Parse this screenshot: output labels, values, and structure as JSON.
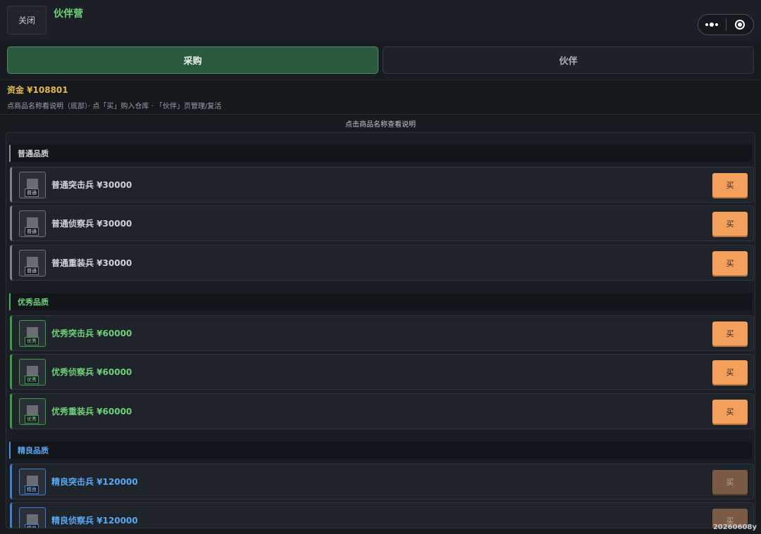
{
  "header": {
    "close_label": "关闭",
    "title": "伙伴营"
  },
  "capsule": {
    "more_icon": "more-dots-icon",
    "record_icon": "target-icon"
  },
  "tabs": [
    {
      "label": "采购",
      "active": true
    },
    {
      "label": "伙伴",
      "active": false
    }
  ],
  "funds": {
    "text": "资金 ¥108801"
  },
  "hint": "点商品名称看说明（底部）· 点「买」购入仓库 · 「伙伴」页管理/复活",
  "center_hint": "点击商品名称查看说明",
  "sections": [
    {
      "title": "普通品质",
      "items": [
        {
          "tag": "普通",
          "name": "普通突击兵 ¥30000",
          "buy": "买"
        },
        {
          "tag": "普通",
          "name": "普通侦察兵 ¥30000",
          "buy": "买"
        },
        {
          "tag": "普通",
          "name": "普通重装兵 ¥30000",
          "buy": "买"
        }
      ]
    },
    {
      "title": "优秀品质",
      "items": [
        {
          "tag": "优秀",
          "name": "优秀突击兵 ¥60000",
          "buy": "买"
        },
        {
          "tag": "优秀",
          "name": "优秀侦察兵 ¥60000",
          "buy": "买"
        },
        {
          "tag": "优秀",
          "name": "优秀重装兵 ¥60000",
          "buy": "买"
        }
      ]
    },
    {
      "title": "精良品质",
      "items": [
        {
          "tag": "精良",
          "name": "精良突击兵 ¥120000",
          "buy": "买"
        },
        {
          "tag": "精良",
          "name": "精良侦察兵 ¥120000",
          "buy": "买"
        }
      ]
    }
  ],
  "version": "20260608y",
  "colors": {
    "accent_green": "#6fd07a",
    "funds_gold": "#e7b74f",
    "buy_orange": "#f2a05b",
    "elite_blue": "#5aa7f2"
  }
}
